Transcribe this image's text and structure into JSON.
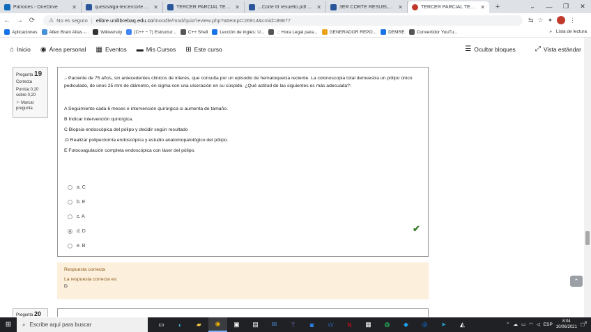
{
  "browser": {
    "tabs": [
      {
        "title": "Patrones - OneDrive",
        "color": "#0f6cbd",
        "active": false
      },
      {
        "title": "quesisalga-tercercorte (1).p...",
        "color": "#2b579a",
        "active": false
      },
      {
        "title": "TERCER PARCIAL TEÓRICO",
        "color": "#2b579a",
        "active": false
      },
      {
        "title": "...Corte III resuelto.pdf - Mic",
        "color": "#2b579a",
        "active": false
      },
      {
        "title": "3ER CORTE RESUELTOU.pdf",
        "color": "#2b579a",
        "active": false
      },
      {
        "title": "TERCER PARCIAL TEÓRICO",
        "color": "#c0392b",
        "active": true
      }
    ],
    "new_tab": "+",
    "window_controls": [
      "—",
      "❐",
      "✕"
    ],
    "address": {
      "security_label": "No es seguro",
      "host": "elibre.unilibrebaq.edu.co",
      "path": "/moodle/mod/quiz/review.php?attempt=26914&cmid=89877"
    },
    "bookmarks": [
      {
        "label": "Aplicaciones",
        "color": "#1a73e8"
      },
      {
        "label": "Allen Brain Atlas -...",
        "color": "#4a90d9"
      },
      {
        "label": "Wikiversity",
        "color": "#333333"
      },
      {
        "label": "(C++ − 7) Estructur...",
        "color": "#4285f4"
      },
      {
        "label": "C++ Shell",
        "color": "#555555"
      },
      {
        "label": "Lección de inglés: U...",
        "color": "#1a73e8"
      },
      {
        "label": ".:: Hora Legal para...",
        "color": "#555555"
      },
      {
        "label": "GENERADOR REPO...",
        "color": "#e8a317"
      },
      {
        "label": "DEMRE",
        "color": "#1a73e8"
      },
      {
        "label": "Convertidor YouTu...",
        "color": "#555555"
      }
    ],
    "bookmarks_overflow": "»",
    "reading_list": "Lista de lectura"
  },
  "moodle_nav": {
    "items": [
      "Inicio",
      "Área personal",
      "Eventos",
      "Mis Cursos",
      "Este curso"
    ],
    "right_items": [
      "Ocultar bloques",
      "Vista estándar"
    ]
  },
  "question": {
    "label": "Pregunta",
    "number": "19",
    "state": "Correcta",
    "score": "Puntúa 0,20 sobre 0,20",
    "flag": "Marcar pregunta",
    "text": ".- Paciente de 75 años, sin antecedentes clínicos de interés, que consulta por un episodio de hematoquecia reciente. La colonoscopia total demuestra un pólipo único pediculado, de unos 25 mm de diámetro, en sigma con una ulceración en su cúspide. ¿Qué actitud de las siguientes es más adecuada?:",
    "options": [
      "A  Seguimiento cada 6 meses e intervención quirúrgica si aumenta de tamaño.",
      "B  Indicar intervención quirúrgica.",
      "C  Biopsia endoscópica del pólipo y decidir según resultado",
      ".D  Realizar polipectomía endoscópica y estudio anatomopatológico del pólipo.",
      "E  Fotocoagulación completa endoscópica con láser del pólipo."
    ],
    "answers": [
      {
        "label": "a. C",
        "selected": false
      },
      {
        "label": "b. E",
        "selected": false
      },
      {
        "label": "c. A",
        "selected": false
      },
      {
        "label": "d. D",
        "selected": true
      },
      {
        "label": "e. B",
        "selected": false
      }
    ]
  },
  "feedback": {
    "status": "Respuesta correcta",
    "correct_label": "La respuesta correcta es:",
    "correct_value": "D"
  },
  "next_question": {
    "label": "Pregunta",
    "number": "20"
  },
  "taskbar": {
    "search_placeholder": "Escribe aquí para buscar",
    "lang": "ESP",
    "time": "8:04",
    "date": "10/06/2021",
    "notif_count": "6"
  }
}
